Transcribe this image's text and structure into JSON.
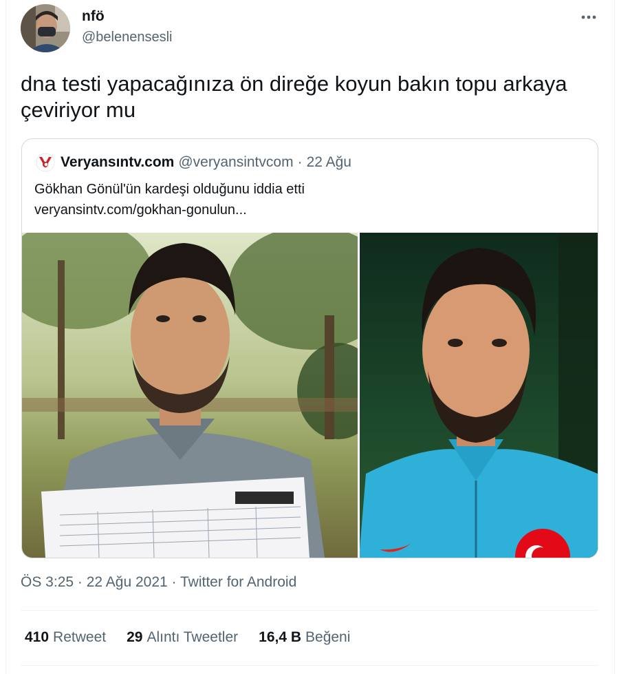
{
  "tweet": {
    "display_name": "nfö",
    "handle": "@belenensesli",
    "text": "dna testi yapacağınıza ön direğe koyun bakın topu arkaya çeviriyor mu",
    "more_icon": "more-dots-icon"
  },
  "quote": {
    "name": "Veryansıntv.com",
    "handle": "@veryansintvcom",
    "dot": "·",
    "date": "22 Ağu",
    "text_line1": "Gökhan Gönül'ün kardeşi olduğunu iddia etti",
    "text_line2": "veryansintv.com/gokhan-gonulun...",
    "logo_icon": "veryansin-logo-icon"
  },
  "meta": {
    "time": "ÖS 3:25",
    "sep1": "·",
    "date": "22 Ağu 2021",
    "sep2": "·",
    "source": "Twitter for Android"
  },
  "stats": {
    "retweets_count": "410",
    "retweets_label": "Retweet",
    "quotes_count": "29",
    "quotes_label": "Alıntı Tweetler",
    "likes_count": "16,4 B",
    "likes_label": "Beğeni"
  },
  "colors": {
    "text_primary": "#0f1419",
    "text_secondary": "#536471",
    "border": "#cfd9de",
    "logo_red": "#d0202a"
  }
}
